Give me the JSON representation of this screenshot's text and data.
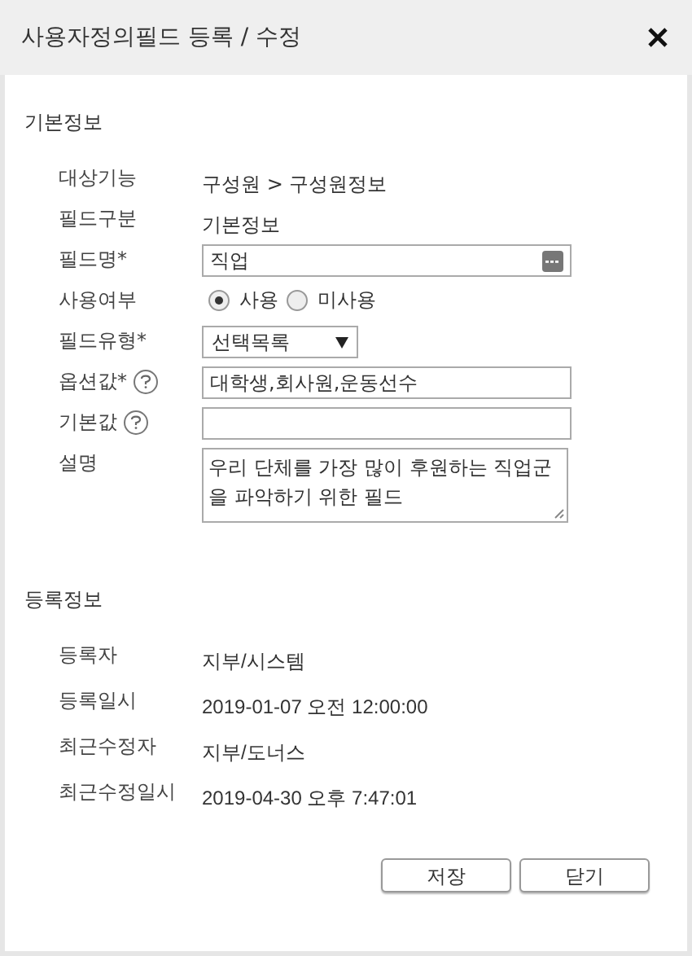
{
  "window": {
    "title": "사용자정의필드 등록 / 수정"
  },
  "sections": [
    {
      "title": "기본정보",
      "rows": [
        {
          "kind": "text",
          "label": "대상기능",
          "value": "구성원 > 구성원정보"
        },
        {
          "kind": "text",
          "label": "필드구분",
          "value": "기본정보"
        },
        {
          "kind": "lookup",
          "label": "필드명*",
          "value": "직업"
        },
        {
          "kind": "radio",
          "label": "사용여부",
          "options": [
            {
              "label": "사용",
              "selected": true
            },
            {
              "label": "미사용",
              "selected": false
            }
          ]
        },
        {
          "kind": "select",
          "label": "필드유형*",
          "value": "선택목록"
        },
        {
          "kind": "input",
          "label": "옵션값*",
          "help": true,
          "value": "대학생,회사원,운동선수"
        },
        {
          "kind": "input",
          "label": "기본값",
          "help": true
        },
        {
          "kind": "textarea",
          "label": "설명",
          "value": "우리 단체를 가장 많이 후원하는 직업군을 파악하기 위한 필드"
        }
      ]
    },
    {
      "title": "등록정보",
      "rows": [
        {
          "kind": "info",
          "label": "등록자",
          "value": "지부/시스템"
        },
        {
          "kind": "info",
          "label": "등록일시",
          "value": "2019-01-07 오전 12:00:00"
        },
        {
          "kind": "info",
          "label": "최근수정자",
          "value": "지부/도너스"
        },
        {
          "kind": "info",
          "label": "최근수정일시",
          "value": "2019-04-30 오후 7:47:01"
        }
      ]
    }
  ],
  "buttons": [
    "저장",
    "닫기"
  ]
}
